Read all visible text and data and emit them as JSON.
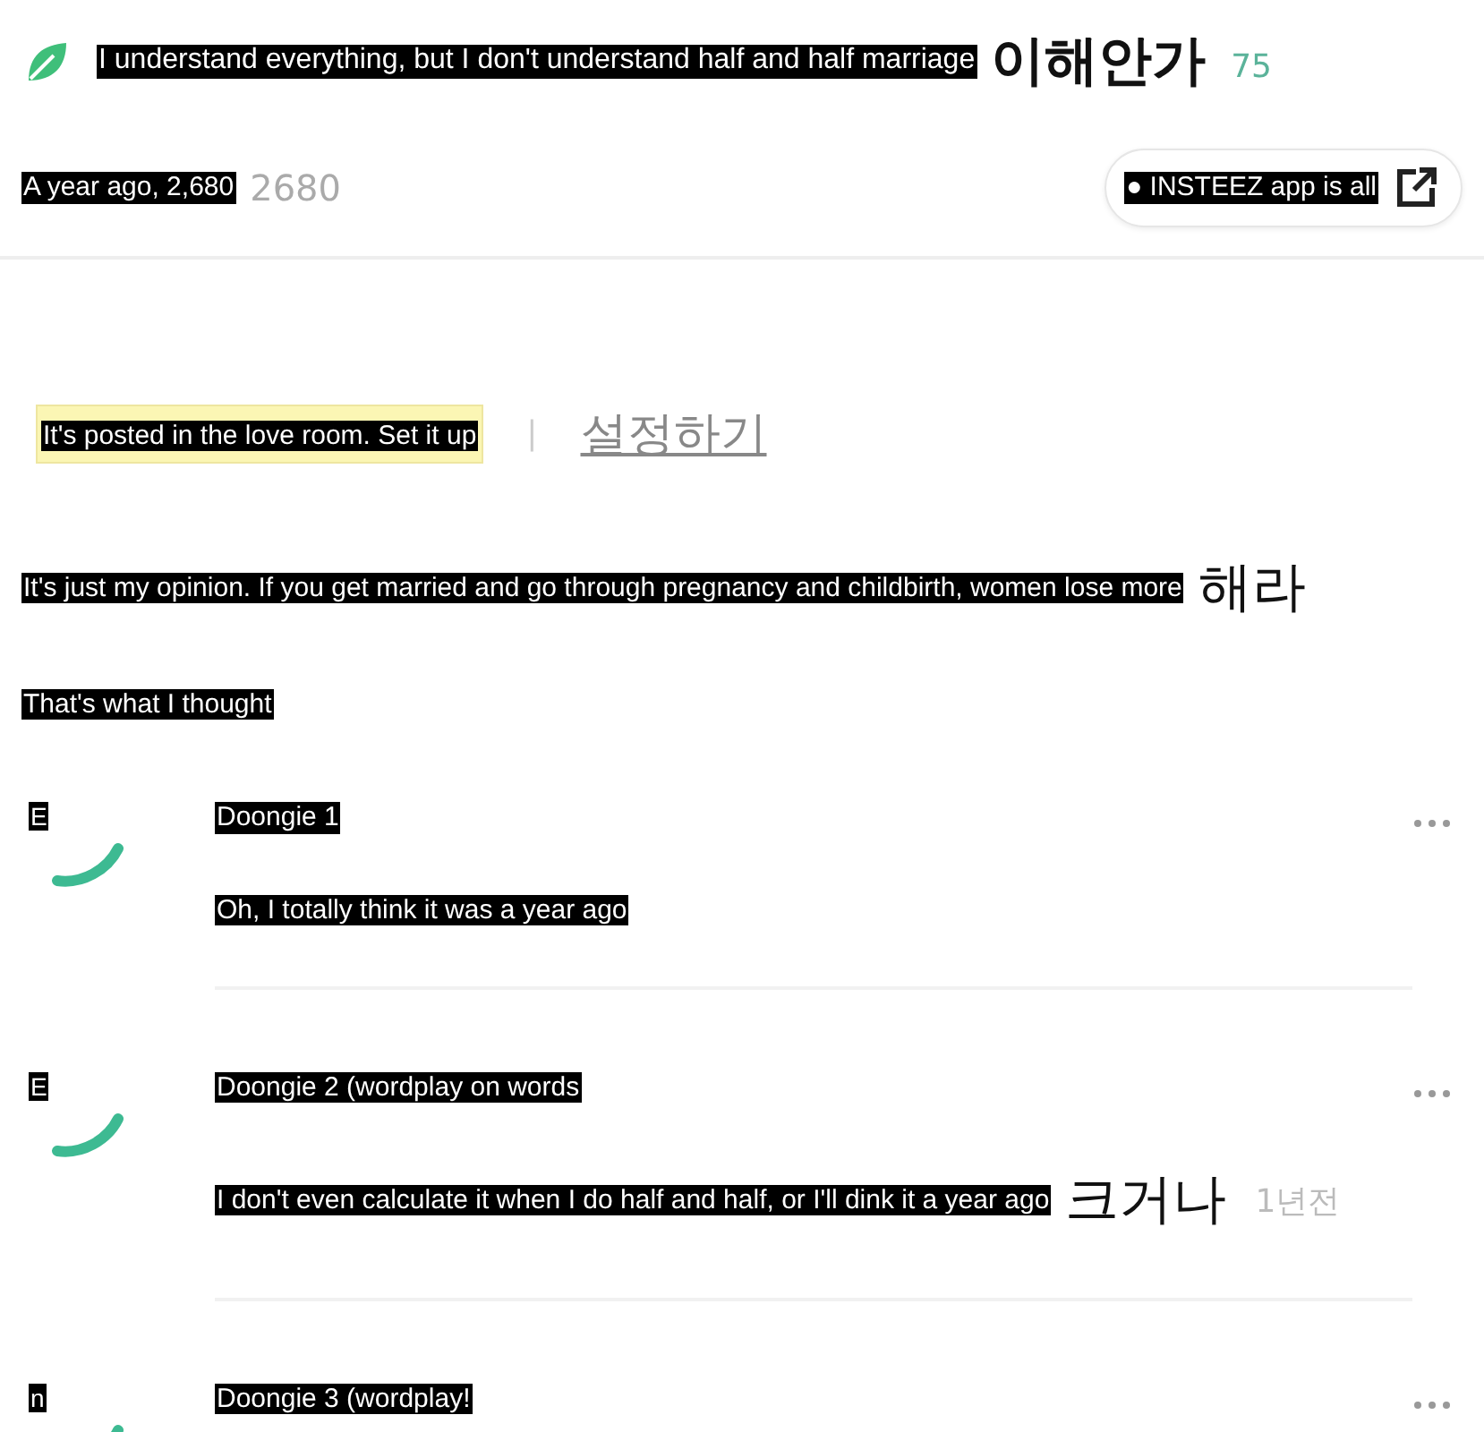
{
  "post": {
    "title": "I understand everything, but I don't understand half and half marriage",
    "title_rest": "이해안가",
    "comment_count": "75",
    "meta": "A year ago, 2,680",
    "views": "2680",
    "app_button": "● INSTEEZ app is all"
  },
  "notice": {
    "text": "It's posted in the love room. Set it up",
    "separator": "|",
    "link": "설정하기"
  },
  "body": [
    {
      "text": "It's just my opinion. If you get married and go through pregnancy and childbirth, women lose more",
      "rest": "해라"
    },
    {
      "text": "That's what I thought"
    }
  ],
  "comments": [
    {
      "avatar_label": "E",
      "name": "Doongie 1",
      "text": "Oh, I totally think it was a year ago"
    },
    {
      "avatar_label": "E",
      "name": "Doongie 2 (wordplay on words",
      "text": "I don't even calculate it when I do half and half, or I'll dink it a year ago",
      "rest": "크거나",
      "time": "1년전"
    },
    {
      "avatar_label": "n",
      "name": "Doongie 3 (wordplay!"
    }
  ]
}
